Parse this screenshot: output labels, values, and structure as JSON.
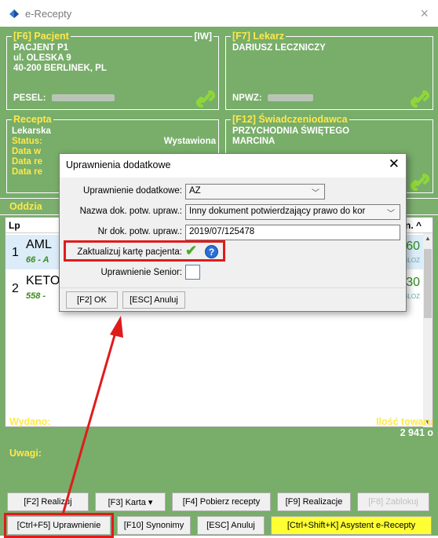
{
  "window": {
    "title": "e-Recepty",
    "close": "×"
  },
  "pacjent": {
    "legend": "[F6] Pacjent",
    "iw": "[IW]",
    "name": "PACJENT P1",
    "street": "ul. OLESKA 9",
    "city": "40-200 BERLINEK, PL",
    "pesel_label": "PESEL:"
  },
  "lekarz": {
    "legend": "[F7] Lekarz",
    "name": "DARIUSZ LECZNICZY",
    "npwz_label": "NPWZ:"
  },
  "recepta": {
    "legend": "Recepta",
    "type": "Lekarska",
    "status_label": "Status:",
    "status_value": "Wystawiona",
    "data1": "Data w",
    "data2": "Data re",
    "data3": "Data re"
  },
  "swiadczeniodawca": {
    "legend": "[F12] Świadczeniodawca",
    "line1": "PRZYCHODNIA ŚWIĘTEGO",
    "line2": "MARCINA"
  },
  "oddzial": {
    "label": "Oddzia"
  },
  "grid": {
    "col_lp": "Lp",
    "col_edn": "edn. ^",
    "rows": [
      {
        "lp": "1",
        "name": "AML",
        "sub": "66 - A",
        "qty": "60",
        "blz": "BLOZ"
      },
      {
        "lp": "2",
        "name": "KETO",
        "sub": "558 -",
        "qty": "30",
        "blz": "BLOZ"
      }
    ],
    "scroll_up": "▲",
    "scroll_down": "▼"
  },
  "summary": {
    "wydano": "Wydano:",
    "ilosc_label": "Ilość towaru",
    "ilosc_value": "2 941 o",
    "uwagi": "Uwagi:"
  },
  "buttons_row1": {
    "realizuj": "[F2] Realizuj",
    "karta": "[F3] Karta ▾",
    "pobierz": "[F4] Pobierz recepty",
    "realizacje": "[F9] Realizacje",
    "zablokuj": "[F8] Zablokuj"
  },
  "buttons_row2": {
    "uprawnienie": "[Ctrl+F5] Uprawnienie",
    "synonimy": "[F10] Synonimy",
    "anuluj": "[ESC] Anuluj",
    "asystent": "[Ctrl+Shift+K] Asystent e-Recepty"
  },
  "dialog": {
    "title": "Uprawnienia dodatkowe",
    "close": "✕",
    "uprawnienie_label": "Uprawnienie dodatkowe:",
    "uprawnienie_value": "AZ",
    "nazwa_label": "Nazwa dok. potw. upraw.:",
    "nazwa_value": "Inny dokument potwierdzający prawo do kor",
    "nr_label": "Nr dok. potw. upraw.:",
    "nr_value": "2019/07/125478",
    "zaktualizuj_label": "Zaktualizuj kartę pacjenta:",
    "zaktualizuj_checked": true,
    "senior_label": "Uprawnienie Senior:",
    "senior_checked": false,
    "ok": "[F2] OK",
    "cancel": "[ESC] Anuluj",
    "help": "?",
    "checkmark": "✔"
  },
  "colors": {
    "panel_bg": "#78ad6a",
    "legend_yellow": "#ffe94a",
    "highlight_red": "#e01b1b",
    "asystent_yellow": "#ffff33"
  }
}
